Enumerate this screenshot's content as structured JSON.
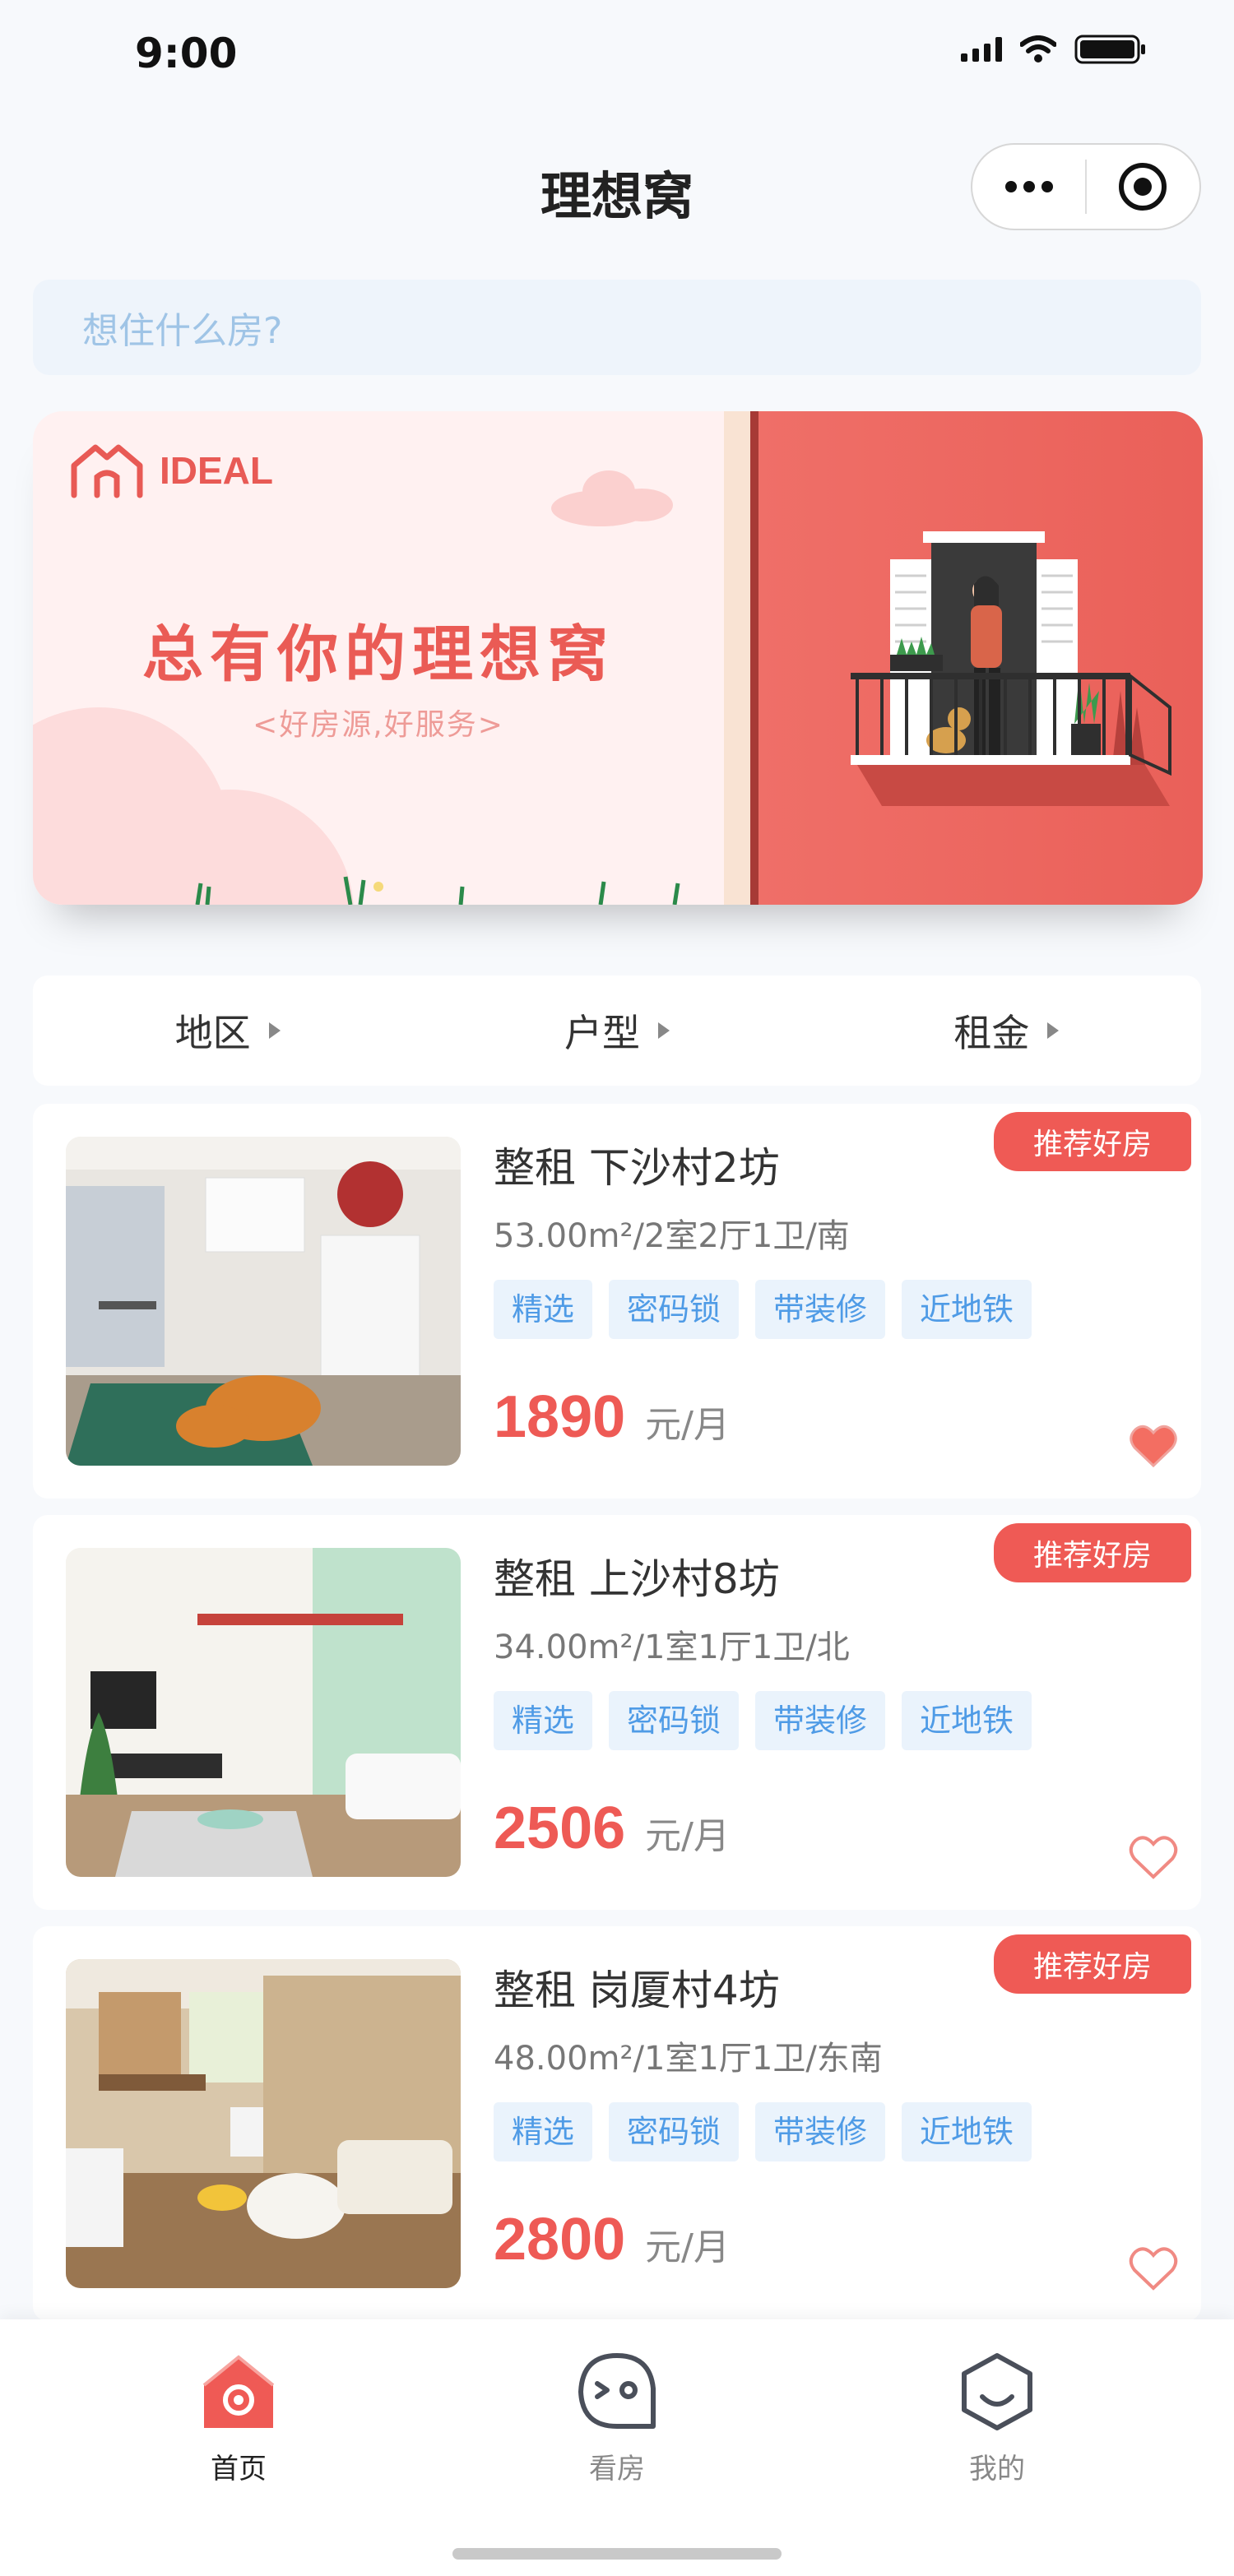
{
  "status_bar": {
    "time": "9:00"
  },
  "nav": {
    "title": "理想窝"
  },
  "search": {
    "placeholder": "想住什么房?"
  },
  "banner": {
    "logo_text": "IDEAL",
    "slogan": "总有你的理想窝",
    "sub_slogan": "<好房源,好服务>"
  },
  "filters": [
    {
      "label": "地区"
    },
    {
      "label": "户型"
    },
    {
      "label": "租金"
    }
  ],
  "listings": [
    {
      "badge": "推荐好房",
      "title": "整租 下沙村2坊",
      "meta": "53.00m²/2室2厅1卫/南",
      "tags": [
        "精选",
        "密码锁",
        "带装修",
        "近地铁"
      ],
      "price": "1890",
      "unit": "元/月",
      "favorited": true
    },
    {
      "badge": "推荐好房",
      "title": "整租 上沙村8坊",
      "meta": "34.00m²/1室1厅1卫/北",
      "tags": [
        "精选",
        "密码锁",
        "带装修",
        "近地铁"
      ],
      "price": "2506",
      "unit": "元/月",
      "favorited": false
    },
    {
      "badge": "推荐好房",
      "title": "整租 岗厦村4坊",
      "meta": "48.00m²/1室1厅1卫/东南",
      "tags": [
        "精选",
        "密码锁",
        "带装修",
        "近地铁"
      ],
      "price": "2800",
      "unit": "元/月",
      "favorited": false
    }
  ],
  "tabbar": [
    {
      "label": "首页",
      "icon": "home-icon",
      "active": true
    },
    {
      "label": "看房",
      "icon": "view-house-icon",
      "active": false
    },
    {
      "label": "我的",
      "icon": "profile-icon",
      "active": false
    }
  ],
  "colors": {
    "accent": "#ef5a55",
    "tag_bg": "#eaf3fc",
    "tag_text": "#4f9be6"
  }
}
